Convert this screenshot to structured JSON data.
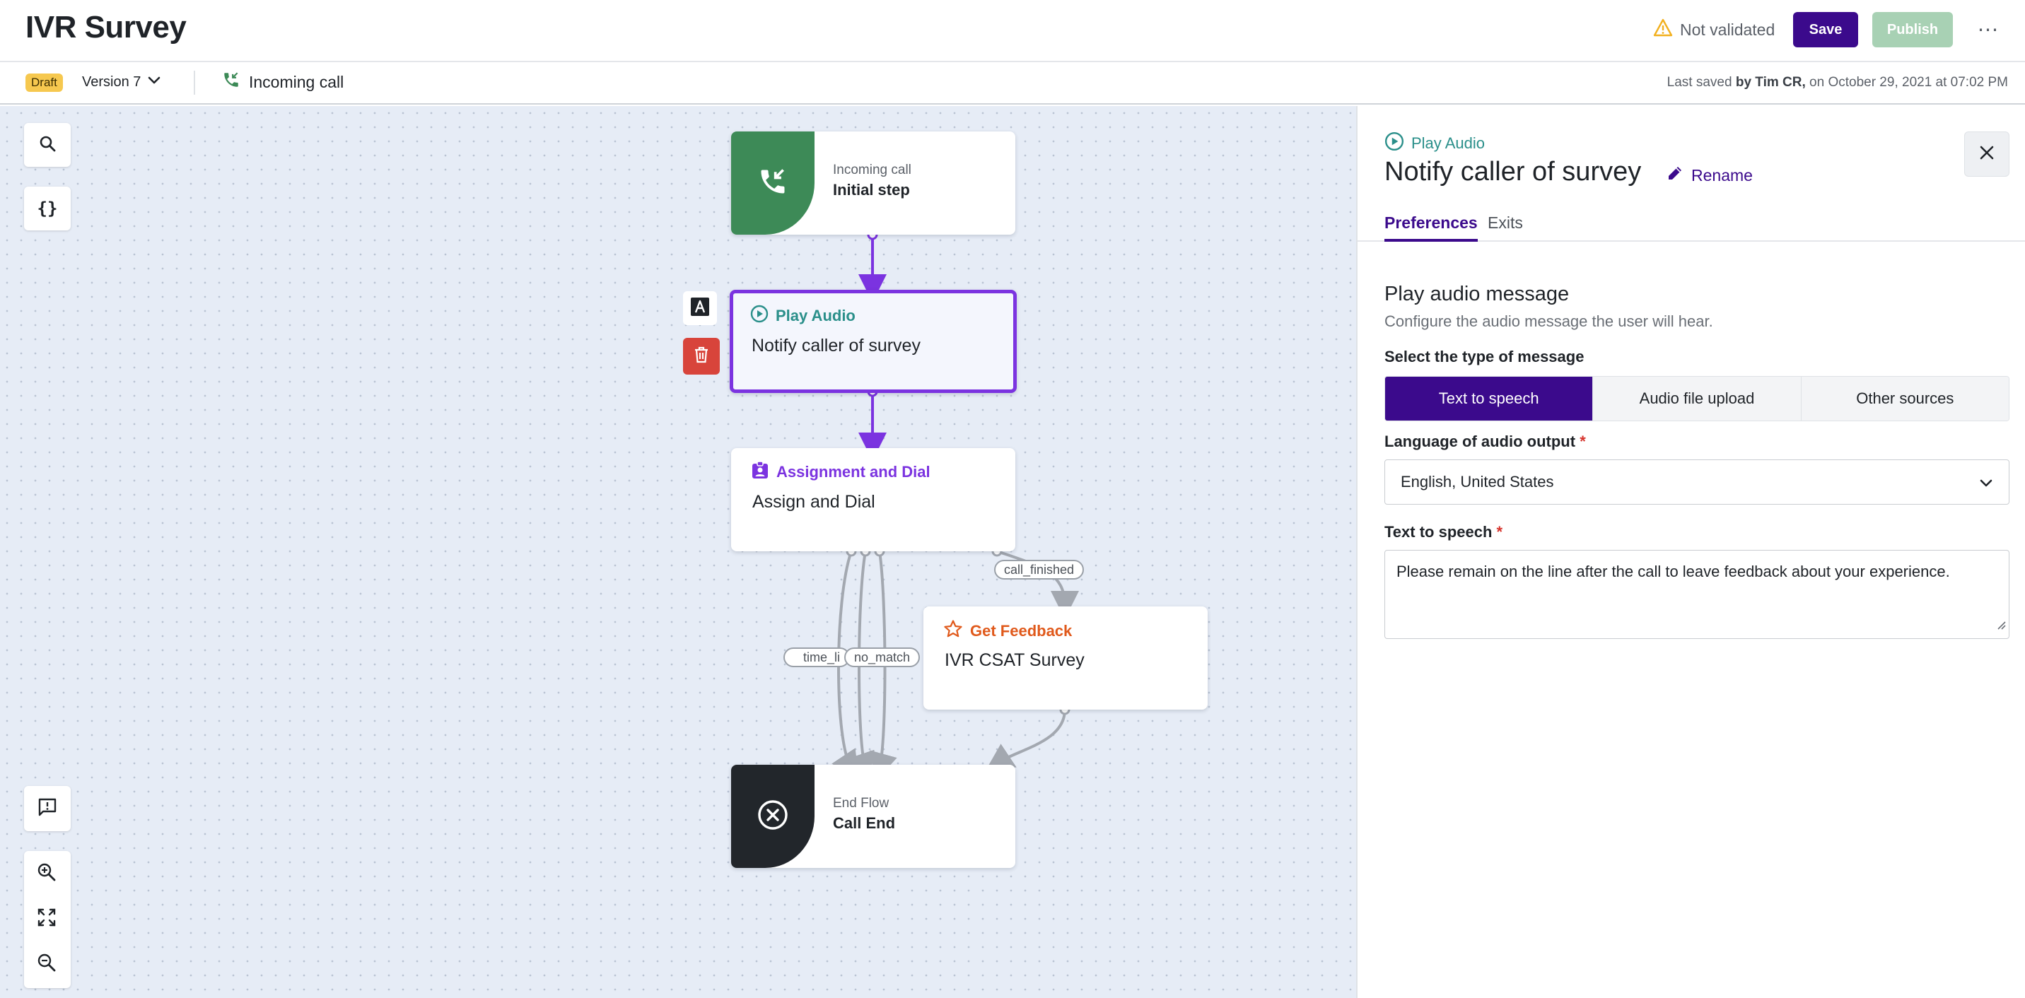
{
  "header": {
    "title": "IVR Survey",
    "validation_status": "Not validated",
    "save_label": "Save",
    "publish_label": "Publish",
    "more_label": "⋯"
  },
  "subbar": {
    "status_badge": "Draft",
    "version_label": "Version 7",
    "trigger_label": "Incoming call",
    "last_saved_prefix": "Last saved",
    "last_saved_by": "by Tim CR,",
    "last_saved_when": "on October 29, 2021 at 07:02 PM"
  },
  "canvas": {
    "nodes": {
      "incoming": {
        "small": "Incoming call",
        "big": "Initial step"
      },
      "play_audio": {
        "type": "Play Audio",
        "name": "Notify caller of survey"
      },
      "assignment": {
        "type": "Assignment and Dial",
        "name": "Assign and Dial"
      },
      "feedback": {
        "type": "Get Feedback",
        "name": "IVR CSAT Survey"
      },
      "end": {
        "small": "End Flow",
        "big": "Call End"
      }
    },
    "edge_labels": {
      "call_finished": "call_finished",
      "time_limit": "time_li",
      "no_match": "no_match"
    },
    "colors": {
      "start_green": "#3d8a57",
      "end_dark": "#22262b",
      "selected_border": "#7b33e0",
      "play_audio": "#2a8f8a",
      "assignment": "#7b33e0",
      "feedback": "#e0591b",
      "delete_red": "#d8443b"
    }
  },
  "panel": {
    "type_label": "Play Audio",
    "node_title": "Notify caller of survey",
    "rename_label": "Rename",
    "tabs": [
      {
        "label": "Preferences",
        "active": true
      },
      {
        "label": "Exits",
        "active": false
      }
    ],
    "section_title": "Play audio message",
    "section_subtitle": "Configure the audio message the user will hear.",
    "message_type_label": "Select the type of message",
    "message_types": [
      {
        "label": "Text to speech",
        "active": true
      },
      {
        "label": "Audio file upload",
        "active": false
      },
      {
        "label": "Other sources",
        "active": false
      }
    ],
    "language_label": "Language of audio output",
    "language_value": "English, United States",
    "tts_label": "Text to speech",
    "tts_value": "Please remain on the line after the call to leave feedback about your experience.",
    "required_mark": "*"
  }
}
